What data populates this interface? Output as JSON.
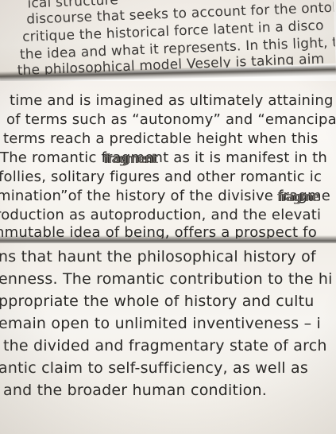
{
  "page": {
    "top_lines": [
      "ical structure",
      "discourse that seeks to account for the ontolo",
      "critique the historical force latent in a disco",
      "the idea and what it represents. In this light, th",
      "the philosophical model Vesely is taking aim"
    ],
    "middle_lines": [
      "time and is imagined as ultimately attaining",
      "of terms such as “autonomy” and “emancipa",
      "terms reach a predictable height when this",
      "The romantic fragment as it is manifest in th",
      "follies, solitary figures and other romantic ic",
      "mination”of the history of the divisive fragme",
      "roduction as autoproduction, and the elevati",
      "nmutable idea of being, offers a prospect fo"
    ],
    "bottom_lines": [
      "ns that haunt the philosophical history of",
      "enness. The romantic contribution to the hi",
      "ppropriate the whole of history and cultu",
      "emain open to unlimited inventiveness – i",
      "the divided and fragmentary state of arch",
      "antic claim to self-sufficiency, as well as",
      "and the broader human condition."
    ],
    "overlay_words": [
      "fragment",
      "fragme"
    ]
  }
}
